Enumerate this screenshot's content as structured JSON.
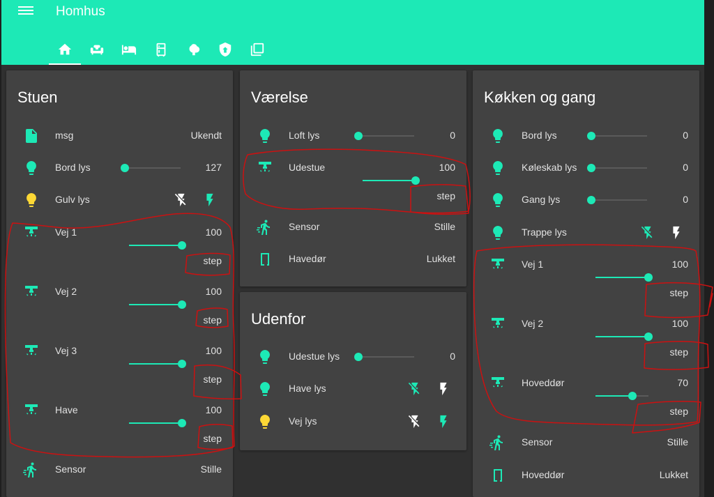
{
  "app": {
    "title": "Homhus"
  },
  "tabs": [
    {
      "icon": "home-icon"
    },
    {
      "icon": "sofa-icon"
    },
    {
      "icon": "bed-icon"
    },
    {
      "icon": "fridge-icon"
    },
    {
      "icon": "tree-icon"
    },
    {
      "icon": "shield-home-icon"
    },
    {
      "icon": "layers-icon"
    }
  ],
  "colors": {
    "accent": "#1de9b6",
    "bulb_on": "#fdd835",
    "card": "#424242",
    "background": "#303030",
    "annotation": "#cc1111"
  },
  "stuen": {
    "title": "Stuen",
    "msg": {
      "label": "msg",
      "value": "Ukendt"
    },
    "bord": {
      "label": "Bord lys",
      "value": "127",
      "level": 0.0
    },
    "gulv": {
      "label": "Gulv lys"
    },
    "vej1": {
      "label": "Vej 1",
      "value": "100",
      "level": 1.0,
      "step": "step"
    },
    "vej2": {
      "label": "Vej 2",
      "value": "100",
      "level": 1.0,
      "step": "step"
    },
    "vej3": {
      "label": "Vej 3",
      "value": "100",
      "level": 1.0,
      "step": "step"
    },
    "have": {
      "label": "Have",
      "value": "100",
      "level": 1.0,
      "step": "step"
    },
    "sensor": {
      "label": "Sensor",
      "value": "Stille"
    }
  },
  "vaerelse": {
    "title": "Værelse",
    "loft": {
      "label": "Loft lys",
      "value": "0",
      "level": 0.0
    },
    "udestue": {
      "label": "Udestue",
      "value": "100",
      "level": 1.0,
      "step": "step"
    },
    "sensor": {
      "label": "Sensor",
      "value": "Stille"
    },
    "havedor": {
      "label": "Havedør",
      "value": "Lukket"
    }
  },
  "udenfor": {
    "title": "Udenfor",
    "udestue_lys": {
      "label": "Udestue lys",
      "value": "0",
      "level": 0.0
    },
    "have_lys": {
      "label": "Have lys"
    },
    "vej_lys": {
      "label": "Vej lys"
    }
  },
  "kokken": {
    "title": "Køkken og gang",
    "bord": {
      "label": "Bord lys",
      "value": "0",
      "level": 0.0
    },
    "koleskab": {
      "label": "Køleskab lys",
      "value": "0",
      "level": 0.0
    },
    "gang": {
      "label": "Gang lys",
      "value": "0",
      "level": 0.0
    },
    "trappe": {
      "label": "Trappe lys"
    },
    "vej1": {
      "label": "Vej 1",
      "value": "100",
      "level": 1.0,
      "step": "step"
    },
    "vej2": {
      "label": "Vej 2",
      "value": "100",
      "level": 1.0,
      "step": "step"
    },
    "hoveddor_dim": {
      "label": "Hoveddør",
      "value": "70",
      "level": 0.7,
      "step": "step"
    },
    "sensor": {
      "label": "Sensor",
      "value": "Stille"
    },
    "hoveddor": {
      "label": "Hoveddør",
      "value": "Lukket"
    }
  }
}
